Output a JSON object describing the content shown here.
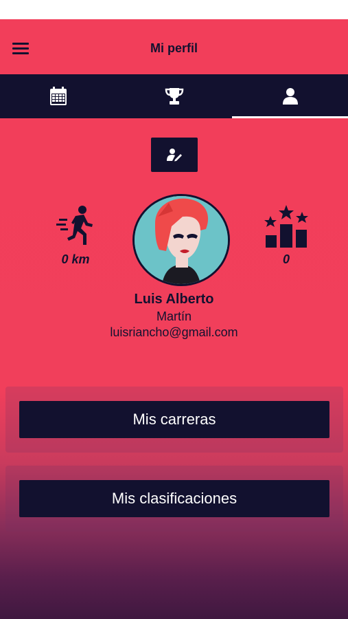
{
  "header": {
    "title": "Mi perfil"
  },
  "tabs": [
    {
      "icon": "calendar-icon"
    },
    {
      "icon": "trophy-icon"
    },
    {
      "icon": "user-icon",
      "active": true
    }
  ],
  "profile": {
    "distance": "0 km",
    "rankings": "0",
    "first_name": "Luis Alberto",
    "last_name": "Martín",
    "email": "luisriancho@gmail.com"
  },
  "actions": {
    "races": "Mis carreras",
    "classifications": "Mis clasificaciones"
  },
  "colors": {
    "background": "#f23e5a",
    "navy": "#12112f",
    "avatar_bg": "#6cc3c8",
    "hair": "#ef4a4a"
  }
}
